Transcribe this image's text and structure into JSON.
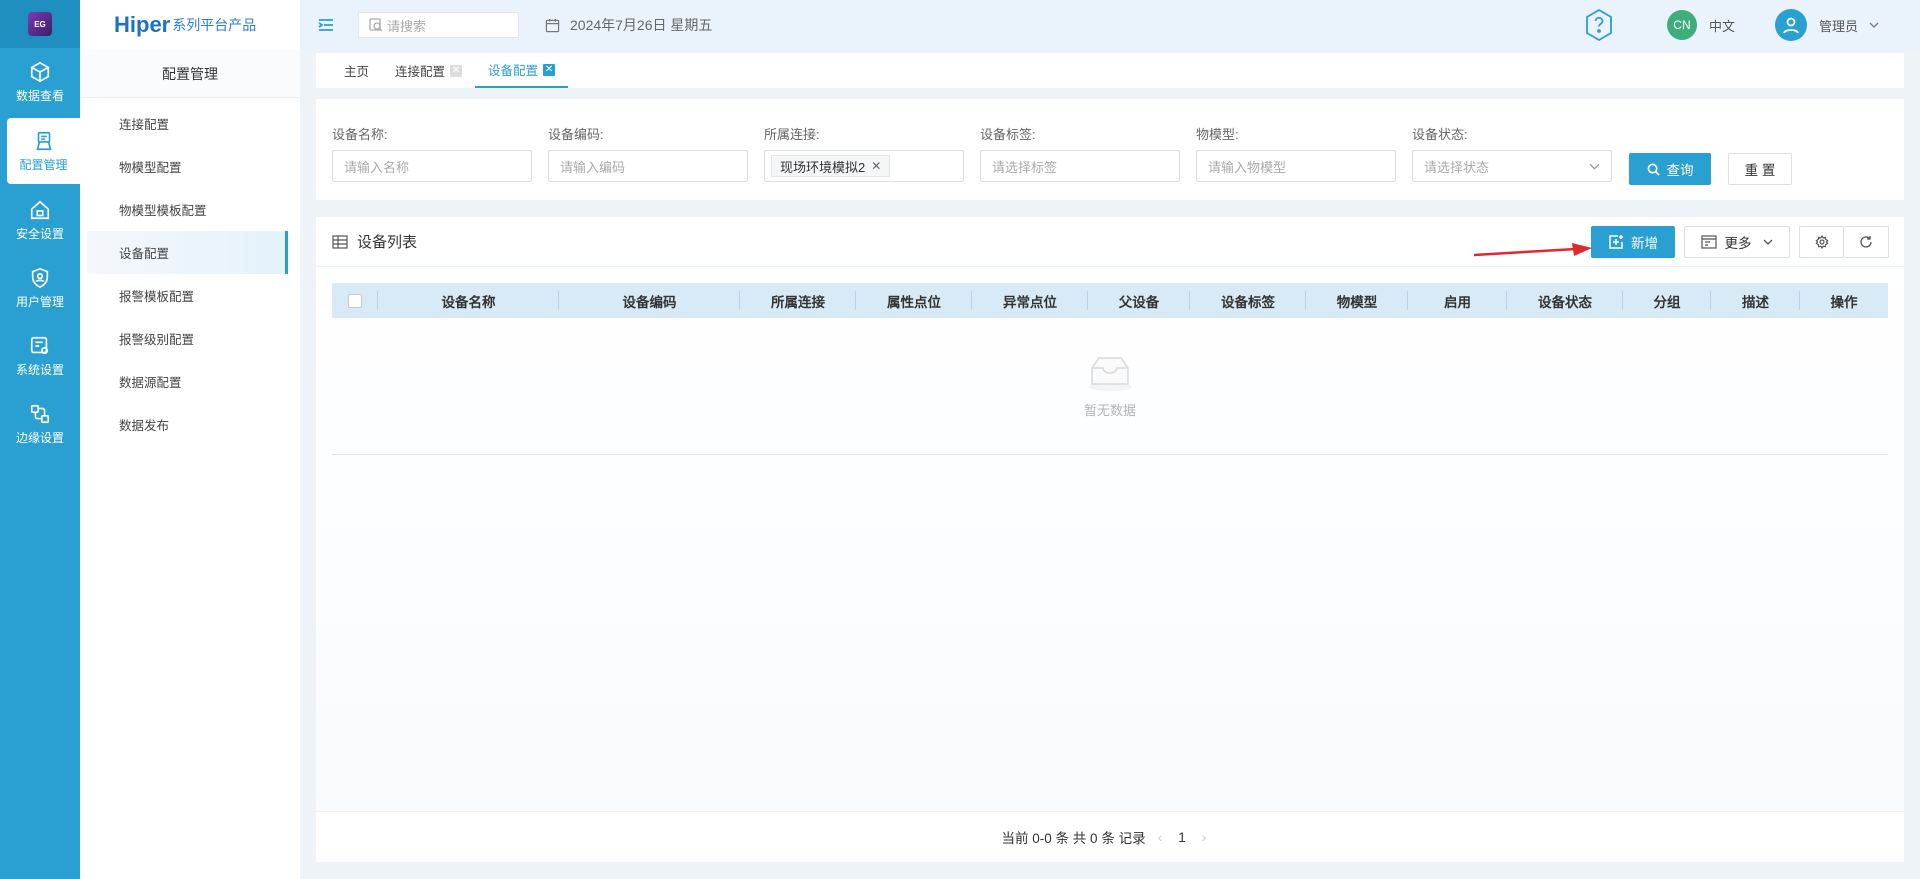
{
  "rail": {
    "items": [
      {
        "label": "数据查看",
        "icon": "cube-icon"
      },
      {
        "label": "配置管理",
        "icon": "config-icon"
      },
      {
        "label": "安全设置",
        "icon": "home-lock-icon"
      },
      {
        "label": "用户管理",
        "icon": "user-shield-icon"
      },
      {
        "label": "系统设置",
        "icon": "system-settings-icon"
      },
      {
        "label": "边缘设置",
        "icon": "edge-icon"
      }
    ],
    "active_index": 1
  },
  "brand": {
    "name": "Hiper",
    "suffix": "系列平台产品"
  },
  "submenu": {
    "title": "配置管理",
    "items": [
      "连接配置",
      "物模型配置",
      "物模型模板配置",
      "设备配置",
      "报警模板配置",
      "报警级别配置",
      "数据源配置",
      "数据发布"
    ],
    "active_index": 3
  },
  "topbar": {
    "search_placeholder": "请搜索",
    "date": "2024年7月26日 星期五",
    "lang_badge": "CN",
    "lang_label": "中文",
    "user": "管理员"
  },
  "tabs": [
    {
      "label": "主页",
      "closable": false
    },
    {
      "label": "连接配置",
      "closable": true
    },
    {
      "label": "设备配置",
      "closable": true,
      "active": true
    }
  ],
  "filter": {
    "device_name": {
      "label": "设备名称:",
      "placeholder": "请输入名称"
    },
    "device_code": {
      "label": "设备编码:",
      "placeholder": "请输入编码"
    },
    "connection": {
      "label": "所属连接:",
      "tag": "现场环境模拟2"
    },
    "device_tag": {
      "label": "设备标签:",
      "placeholder": "请选择标签"
    },
    "model": {
      "label": "物模型:",
      "placeholder": "请输入物模型"
    },
    "status": {
      "label": "设备状态:",
      "placeholder": "请选择状态"
    },
    "query_label": "查询",
    "reset_label": "重 置"
  },
  "table": {
    "title": "设备列表",
    "add_label": "新增",
    "more_label": "更多",
    "columns": [
      "设备名称",
      "设备编码",
      "所属连接",
      "属性点位",
      "异常点位",
      "父设备",
      "设备标签",
      "物模型",
      "启用",
      "设备状态",
      "分组",
      "描述",
      "操作"
    ],
    "empty_text": "暂无数据"
  },
  "pager": {
    "summary": "当前 0-0 条 共 0 条 记录",
    "page": "1"
  },
  "colors": {
    "primary": "#2a9fd1",
    "rail": "#2a9fd1",
    "annotation_arrow": "#e0292b"
  }
}
